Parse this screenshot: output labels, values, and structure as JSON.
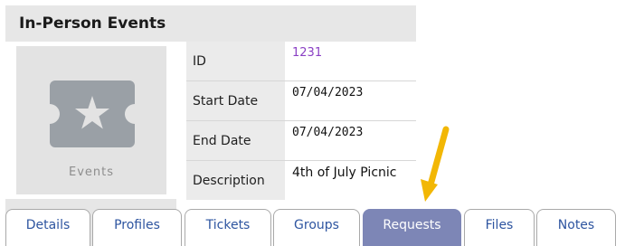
{
  "panel": {
    "title": "In-Person Events"
  },
  "thumbnail": {
    "icon": "ticket-star-icon",
    "label": "Events"
  },
  "fields": [
    {
      "label": "ID",
      "value": "1231"
    },
    {
      "label": "Start Date",
      "value": "07/04/2023"
    },
    {
      "label": "End Date",
      "value": "07/04/2023"
    },
    {
      "label": "Description",
      "value": "4th of July Picnic"
    }
  ],
  "tabs": [
    {
      "label": "Details",
      "active": false
    },
    {
      "label": "Profiles",
      "active": false
    },
    {
      "label": "Tickets",
      "active": false
    },
    {
      "label": "Groups",
      "active": false
    },
    {
      "label": "Requests",
      "active": true
    },
    {
      "label": "Files",
      "active": false
    },
    {
      "label": "Notes",
      "active": false
    }
  ],
  "colors": {
    "active_tab": "#7d86b6",
    "tab_text": "#2e55a0",
    "id_link": "#8a3fc4",
    "arrow": "#f2b705"
  }
}
